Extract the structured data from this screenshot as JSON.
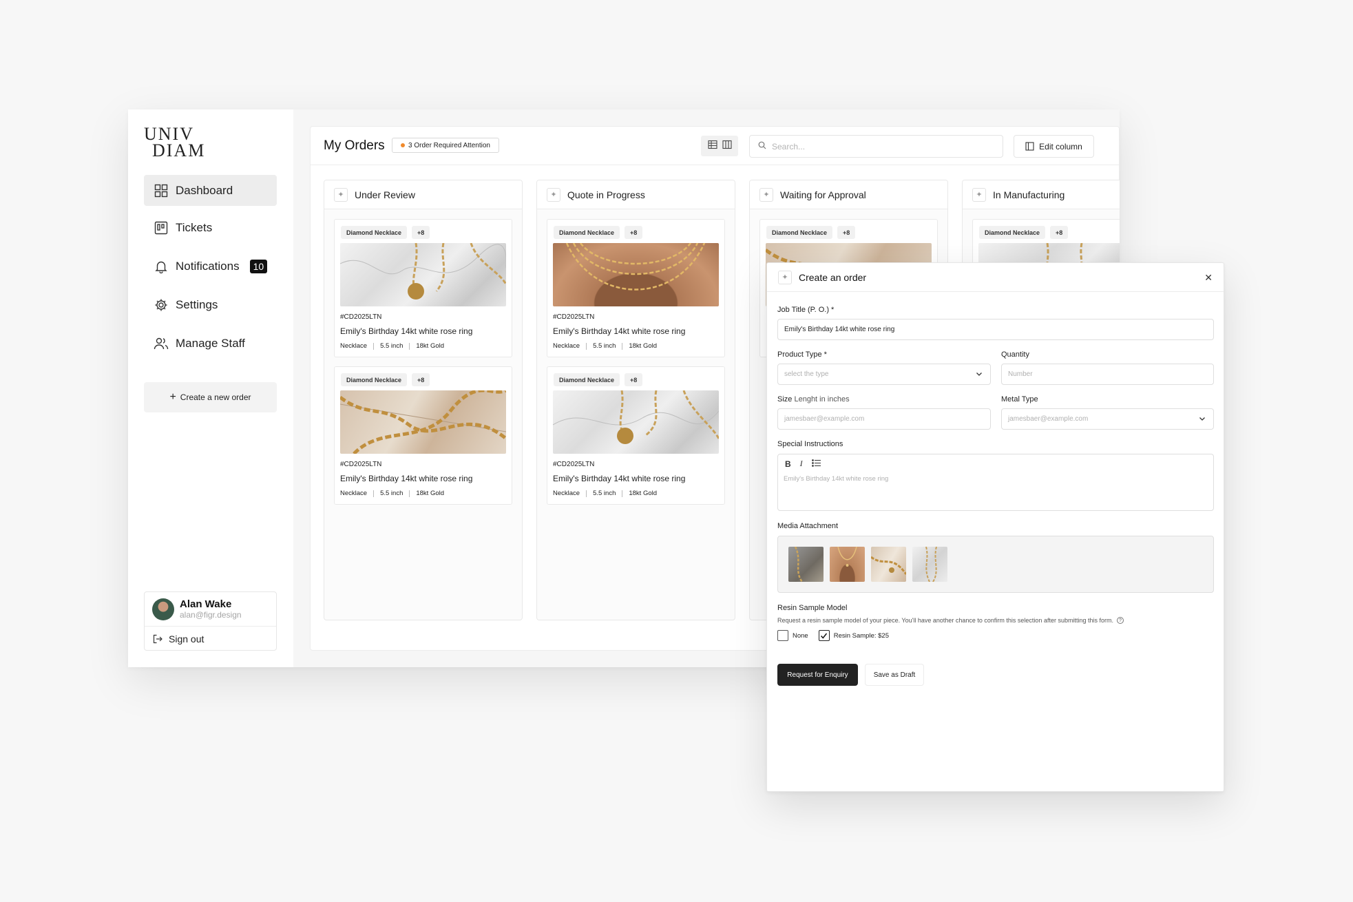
{
  "brand": {
    "line1": "UNIV",
    "line2": "DIAM"
  },
  "sidebar": {
    "items": [
      {
        "label": "Dashboard",
        "icon": "dashboard-icon",
        "active": true
      },
      {
        "label": "Tickets",
        "icon": "tickets-icon"
      },
      {
        "label": "Notifications",
        "icon": "bell-icon",
        "badge": "10"
      },
      {
        "label": "Settings",
        "icon": "gear-icon"
      },
      {
        "label": "Manage Staff",
        "icon": "users-icon"
      }
    ],
    "create_label": "Create a new order"
  },
  "user": {
    "name": "Alan Wake",
    "email": "alan@figr.design",
    "signout_label": "Sign out"
  },
  "header": {
    "title": "My Orders",
    "attention_badge": "3 Order Required Attention",
    "search_placeholder": "Search...",
    "edit_column_label": "Edit column"
  },
  "columns": [
    {
      "title": "Under Review"
    },
    {
      "title": "Quote in Progress"
    },
    {
      "title": "Waiting for Approval"
    },
    {
      "title": "In Manufacturing"
    }
  ],
  "cards": {
    "tag": "Diamond Necklace",
    "more": "+8",
    "code": "#CD2025LTN",
    "title": "Emily's Birthday 14kt white rose ring",
    "meta": [
      "Necklace",
      "5.5 inch",
      "18kt Gold"
    ]
  },
  "modal": {
    "title": "Create an order",
    "job_title_label": "Job Title (P. O.) *",
    "job_title_value": "Emily's Birthday 14kt white rose ring",
    "product_type_label": "Product Type *",
    "product_type_placeholder": "select the type",
    "quantity_label": "Quantity",
    "quantity_placeholder": "Number",
    "size_label": "Size",
    "size_label_hint": "Lenght in inches",
    "size_placeholder": "jamesbaer@example.com",
    "metal_label": "Metal Type",
    "metal_placeholder": "jamesbaer@example.com",
    "instructions_label": "Special Instructions",
    "instructions_placeholder": "Emily's Birthday 14kt white rose ring",
    "media_label": "Media Attachment",
    "resin_label": "Resin Sample Model",
    "resin_hint": "Request a resin sample model of your piece. You'll have another chance to confirm this selection after submitting this form.",
    "option_none": "None",
    "option_resin": "Resin Sample: $25",
    "primary_button": "Request for Enquiry",
    "secondary_button": "Save as Draft"
  },
  "colors": {
    "accent_dot": "#f08a2c",
    "primary_button": "#222222",
    "badge_bg": "#111111"
  }
}
